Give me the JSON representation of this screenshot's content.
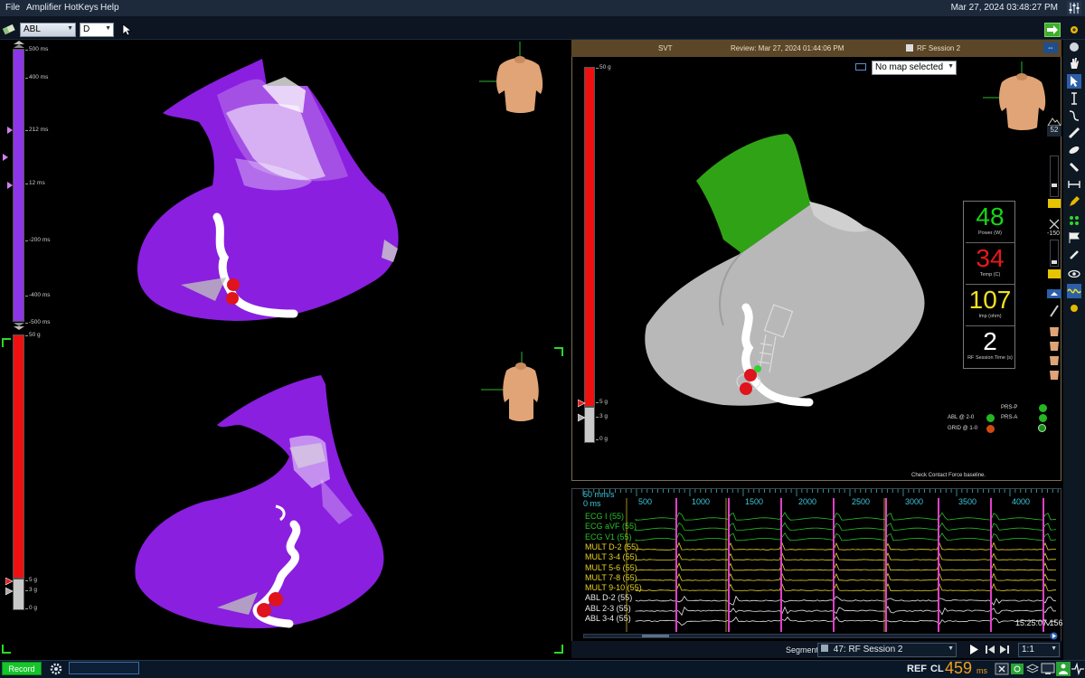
{
  "menu": {
    "items": [
      "File",
      "Amplifier",
      "HotKeys",
      "Help"
    ],
    "clock": "Mar 27, 2024 03:48:27 PM"
  },
  "toolbar": {
    "catheter_select": "ABL",
    "mode_select": "D"
  },
  "left_panel": {
    "time_bar": {
      "ticks": [
        "500 ms",
        "400 ms",
        "212 ms",
        "12 ms",
        "-200 ms",
        "-400 ms",
        "-500 ms"
      ]
    },
    "force_bar": {
      "ticks": [
        "50 g",
        "5 g",
        "3 g",
        "0 g"
      ]
    }
  },
  "right_panel": {
    "header": {
      "map_name": "SVT",
      "review": "Review: Mar 27, 2024 01:44:06 PM",
      "session": "RF Session 2"
    },
    "map_select": "No map selected",
    "force_bar": {
      "ticks": [
        "50 g",
        "5 g",
        "3 g",
        "0 g"
      ]
    },
    "readouts": [
      {
        "value": "48",
        "label": "Power (W)",
        "color": "#18d418"
      },
      {
        "value": "34",
        "label": "Temp (C)",
        "color": "#e81818"
      },
      {
        "value": "107",
        "label": "Imp (ohm)",
        "color": "#f0e020"
      },
      {
        "value": "2",
        "label": "RF Session Time (s)",
        "color": "#ffffff"
      }
    ],
    "status": {
      "prs_p": "PRS-P",
      "prs_a": "PRS-A",
      "abl": "ABL @ 2-0",
      "grid": "GRID @ 1-0",
      "message": "Check Contact Force baseline."
    }
  },
  "ecg_panel": {
    "speed": "50 mm/s",
    "zero_label": "0 ms",
    "axis_ticks": [
      "500",
      "1000",
      "1500",
      "2000",
      "2500",
      "3000",
      "3500",
      "4000"
    ],
    "channels": [
      {
        "label": "ECG I (55)",
        "color": "#27c227"
      },
      {
        "label": "ECG aVF (55)",
        "color": "#27c227"
      },
      {
        "label": "ECG V1 (55)",
        "color": "#27c227"
      },
      {
        "label": "MULT   D-2 (55)",
        "color": "#e8d320"
      },
      {
        "label": "MULT   3-4 (55)",
        "color": "#e8d320"
      },
      {
        "label": "MULT   5-6 (55)",
        "color": "#e8d320"
      },
      {
        "label": "MULT   7-8 (55)",
        "color": "#e8d320"
      },
      {
        "label": "MULT   9-10 (55)",
        "color": "#e8d320"
      },
      {
        "label": "ABL   D-2 (55)",
        "color": "#e8e8e8"
      },
      {
        "label": "ABL   2-3 (55)",
        "color": "#e8e8e8"
      },
      {
        "label": "ABL   3-4 (55)",
        "color": "#e8e8e8"
      }
    ],
    "timestamp": "15:25:07.156"
  },
  "segment_bar": {
    "label": "Segment",
    "segment_value": "47: RF Session 2",
    "ratio": "1:1"
  },
  "statusbar": {
    "record": "Record",
    "ref": "REF",
    "cl_label": "CL",
    "cl_value": "459",
    "cl_unit": "ms"
  },
  "colors": {
    "map_purple": "#8a1fe0",
    "map_green": "#2fa315",
    "map_gray": "#b8b8b8",
    "lesion_red": "#e0141c",
    "pacing_magenta": "#e040c8"
  }
}
